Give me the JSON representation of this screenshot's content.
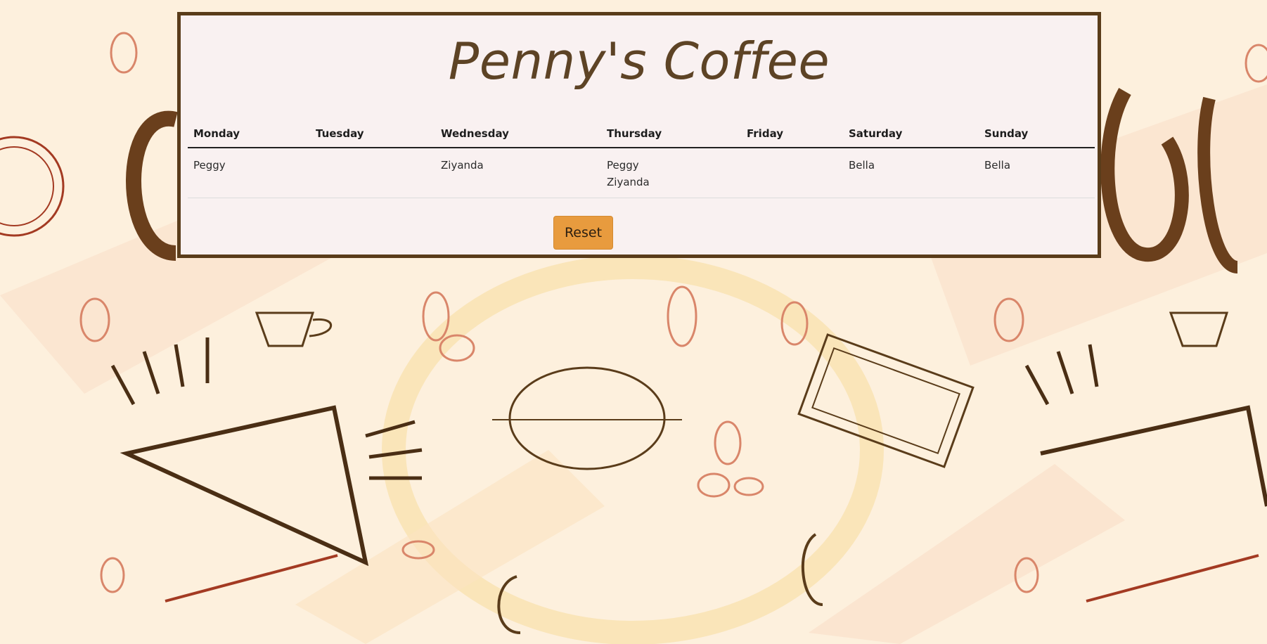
{
  "app": {
    "title": "Penny's Coffee"
  },
  "schedule": {
    "days": [
      "Monday",
      "Tuesday",
      "Wednesday",
      "Thursday",
      "Friday",
      "Saturday",
      "Sunday"
    ],
    "assignments": [
      [
        "Peggy"
      ],
      [],
      [
        "Ziyanda"
      ],
      [
        "Peggy",
        "Ziyanda"
      ],
      [],
      [
        "Bella"
      ],
      [
        "Bella"
      ]
    ]
  },
  "actions": {
    "reset_label": "Reset"
  },
  "colors": {
    "card_border": "#5a3c1a",
    "card_background": "#f9f1f1",
    "title": "#5d4325",
    "reset_button": "#e89b3e",
    "page_background": "#fdf0dd"
  }
}
